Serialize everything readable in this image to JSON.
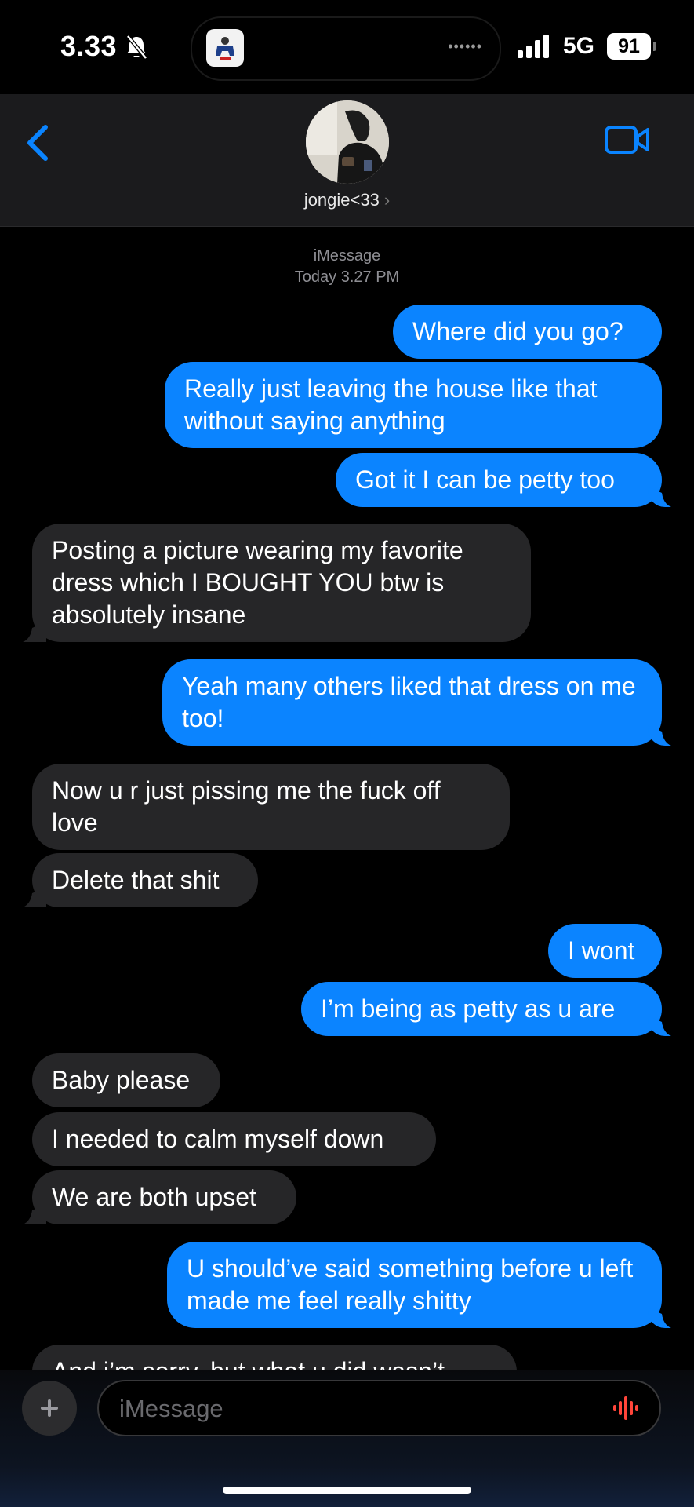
{
  "status_bar": {
    "time": "3.33",
    "network": "5G",
    "battery": "91"
  },
  "header": {
    "contact_name": "jongie<33",
    "chevron": "›"
  },
  "thread": {
    "service": "iMessage",
    "timestamp": "Today 3.27 PM",
    "messages": [
      {
        "dir": "out",
        "text": "Where did you go?"
      },
      {
        "dir": "out",
        "text": "Really just leaving the house like that without saying anything"
      },
      {
        "dir": "out",
        "text": "Got it I can be petty too"
      },
      {
        "dir": "in",
        "text": "Posting a picture wearing my favorite dress which I BOUGHT YOU btw is absolutely insane"
      },
      {
        "dir": "out",
        "text": "Yeah many others liked that dress on me too!"
      },
      {
        "dir": "in",
        "text": "Now u r just pissing me the fuck off love"
      },
      {
        "dir": "in",
        "text": "Delete that shit"
      },
      {
        "dir": "out",
        "text": "I wont"
      },
      {
        "dir": "out",
        "text": "I’m being as petty as u are"
      },
      {
        "dir": "in",
        "text": "Baby please"
      },
      {
        "dir": "in",
        "text": "I needed to calm myself down"
      },
      {
        "dir": "in",
        "text": "We are both upset"
      },
      {
        "dir": "out",
        "text": "U should’ve said something before u left made me feel really shitty"
      },
      {
        "dir": "in",
        "text": "And i’m sorry, but what u did wasn’t"
      }
    ]
  },
  "composer": {
    "placeholder": "iMessage"
  },
  "colors": {
    "outgoing": "#0b84ff",
    "incoming": "#262628",
    "accent": "#0a84ff",
    "mic": "#ff453a"
  }
}
